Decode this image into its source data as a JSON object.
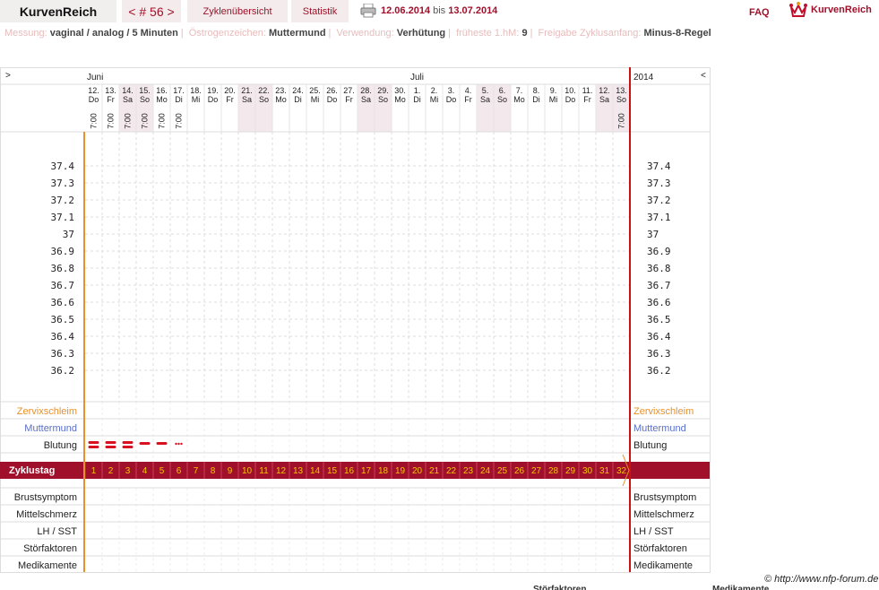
{
  "header": {
    "brand": "KurvenReich",
    "cycle_nav": "< # 56 >",
    "tab_overview": "Zyklenübersicht",
    "tab_stats": "Statistik",
    "date_from": "12.06.2014",
    "date_sep": "bis",
    "date_to": "13.07.2014",
    "faq": "FAQ",
    "logo_text": "KurvenReich"
  },
  "info": {
    "messung_label": "Messung:",
    "messung_value": "vaginal / analog / 5 Minuten",
    "oestrogen_label": "Östrogenzeichen:",
    "oestrogen_value": "Muttermund",
    "verwendung_label": "Verwendung:",
    "verwendung_value": "Verhütung",
    "fruehe_label": "früheste 1.hM:",
    "fruehe_value": "9",
    "freigabe_label": "Freigabe Zyklusanfang:",
    "freigabe_value": "Minus-8-Regel"
  },
  "chart": {
    "nav_prev": ">",
    "nav_next": "<",
    "year": "2014",
    "months": [
      {
        "label": "Juni",
        "col": 0
      },
      {
        "label": "Juli",
        "col": 19
      }
    ],
    "days": [
      {
        "d": "12.",
        "w": "Do",
        "t": "7:00",
        "we": false
      },
      {
        "d": "13.",
        "w": "Fr",
        "t": "7:00",
        "we": false
      },
      {
        "d": "14.",
        "w": "Sa",
        "t": "7:00",
        "we": true
      },
      {
        "d": "15.",
        "w": "So",
        "t": "7:00",
        "we": true
      },
      {
        "d": "16.",
        "w": "Mo",
        "t": "7:00",
        "we": false
      },
      {
        "d": "17.",
        "w": "Di",
        "t": "7:00",
        "we": false
      },
      {
        "d": "18.",
        "w": "Mi",
        "t": "",
        "we": false
      },
      {
        "d": "19.",
        "w": "Do",
        "t": "",
        "we": false
      },
      {
        "d": "20.",
        "w": "Fr",
        "t": "",
        "we": false
      },
      {
        "d": "21.",
        "w": "Sa",
        "t": "",
        "we": true
      },
      {
        "d": "22.",
        "w": "So",
        "t": "",
        "we": true
      },
      {
        "d": "23.",
        "w": "Mo",
        "t": "",
        "we": false
      },
      {
        "d": "24.",
        "w": "Di",
        "t": "",
        "we": false
      },
      {
        "d": "25.",
        "w": "Mi",
        "t": "",
        "we": false
      },
      {
        "d": "26.",
        "w": "Do",
        "t": "",
        "we": false
      },
      {
        "d": "27.",
        "w": "Fr",
        "t": "",
        "we": false
      },
      {
        "d": "28.",
        "w": "Sa",
        "t": "",
        "we": true
      },
      {
        "d": "29.",
        "w": "So",
        "t": "",
        "we": true
      },
      {
        "d": "30.",
        "w": "Mo",
        "t": "",
        "we": false
      },
      {
        "d": "1.",
        "w": "Di",
        "t": "",
        "we": false
      },
      {
        "d": "2.",
        "w": "Mi",
        "t": "",
        "we": false
      },
      {
        "d": "3.",
        "w": "Do",
        "t": "",
        "we": false
      },
      {
        "d": "4.",
        "w": "Fr",
        "t": "",
        "we": false
      },
      {
        "d": "5.",
        "w": "Sa",
        "t": "",
        "we": true
      },
      {
        "d": "6.",
        "w": "So",
        "t": "",
        "we": true
      },
      {
        "d": "7.",
        "w": "Mo",
        "t": "",
        "we": false
      },
      {
        "d": "8.",
        "w": "Di",
        "t": "",
        "we": false
      },
      {
        "d": "9.",
        "w": "Mi",
        "t": "",
        "we": false
      },
      {
        "d": "10.",
        "w": "Do",
        "t": "",
        "we": false
      },
      {
        "d": "11.",
        "w": "Fr",
        "t": "",
        "we": false
      },
      {
        "d": "12.",
        "w": "Sa",
        "t": "",
        "we": true
      },
      {
        "d": "13.",
        "w": "So",
        "t": "7:00",
        "we": true
      }
    ],
    "temps": [
      "37.4",
      "37.3",
      "37.2",
      "37.1",
      "37",
      "36.9",
      "36.8",
      "36.7",
      "36.6",
      "36.5",
      "36.4",
      "36.3",
      "36.2"
    ],
    "row_zervix": "Zervixschleim",
    "row_mumu": "Muttermund",
    "row_blutung": "Blutung",
    "row_zyklustag": "Zyklustag",
    "bleeding": [
      "strong",
      "strong",
      "strong",
      "medium",
      "medium",
      "spotting"
    ],
    "cycle_days": [
      "1",
      "2",
      "3",
      "4",
      "5",
      "6",
      "7",
      "8",
      "9",
      "10",
      "11",
      "12",
      "13",
      "14",
      "15",
      "16",
      "17",
      "18",
      "19",
      "20",
      "21",
      "22",
      "23",
      "24",
      "25",
      "26",
      "27",
      "28",
      "29",
      "30",
      "31",
      "32"
    ],
    "extra_rows": [
      "Brustsymptom",
      "Mittelschmerz",
      "LH / SST",
      "Störfaktoren",
      "Medikamente"
    ],
    "colors": {
      "accent": "#a1102a",
      "cycle_bar": "#a0102a",
      "cycle_num": "#f5c400",
      "weekend": "#f3e8ec",
      "orange": "#e8902a",
      "red_line": "#cc1111",
      "zervix": "#e8902a",
      "mumu": "#5a6fc8"
    }
  },
  "footer": {
    "copyright": "© http://www.nfp-forum.de",
    "cut_stoer": "Störfaktoren",
    "cut_medi": "Medikamente"
  }
}
